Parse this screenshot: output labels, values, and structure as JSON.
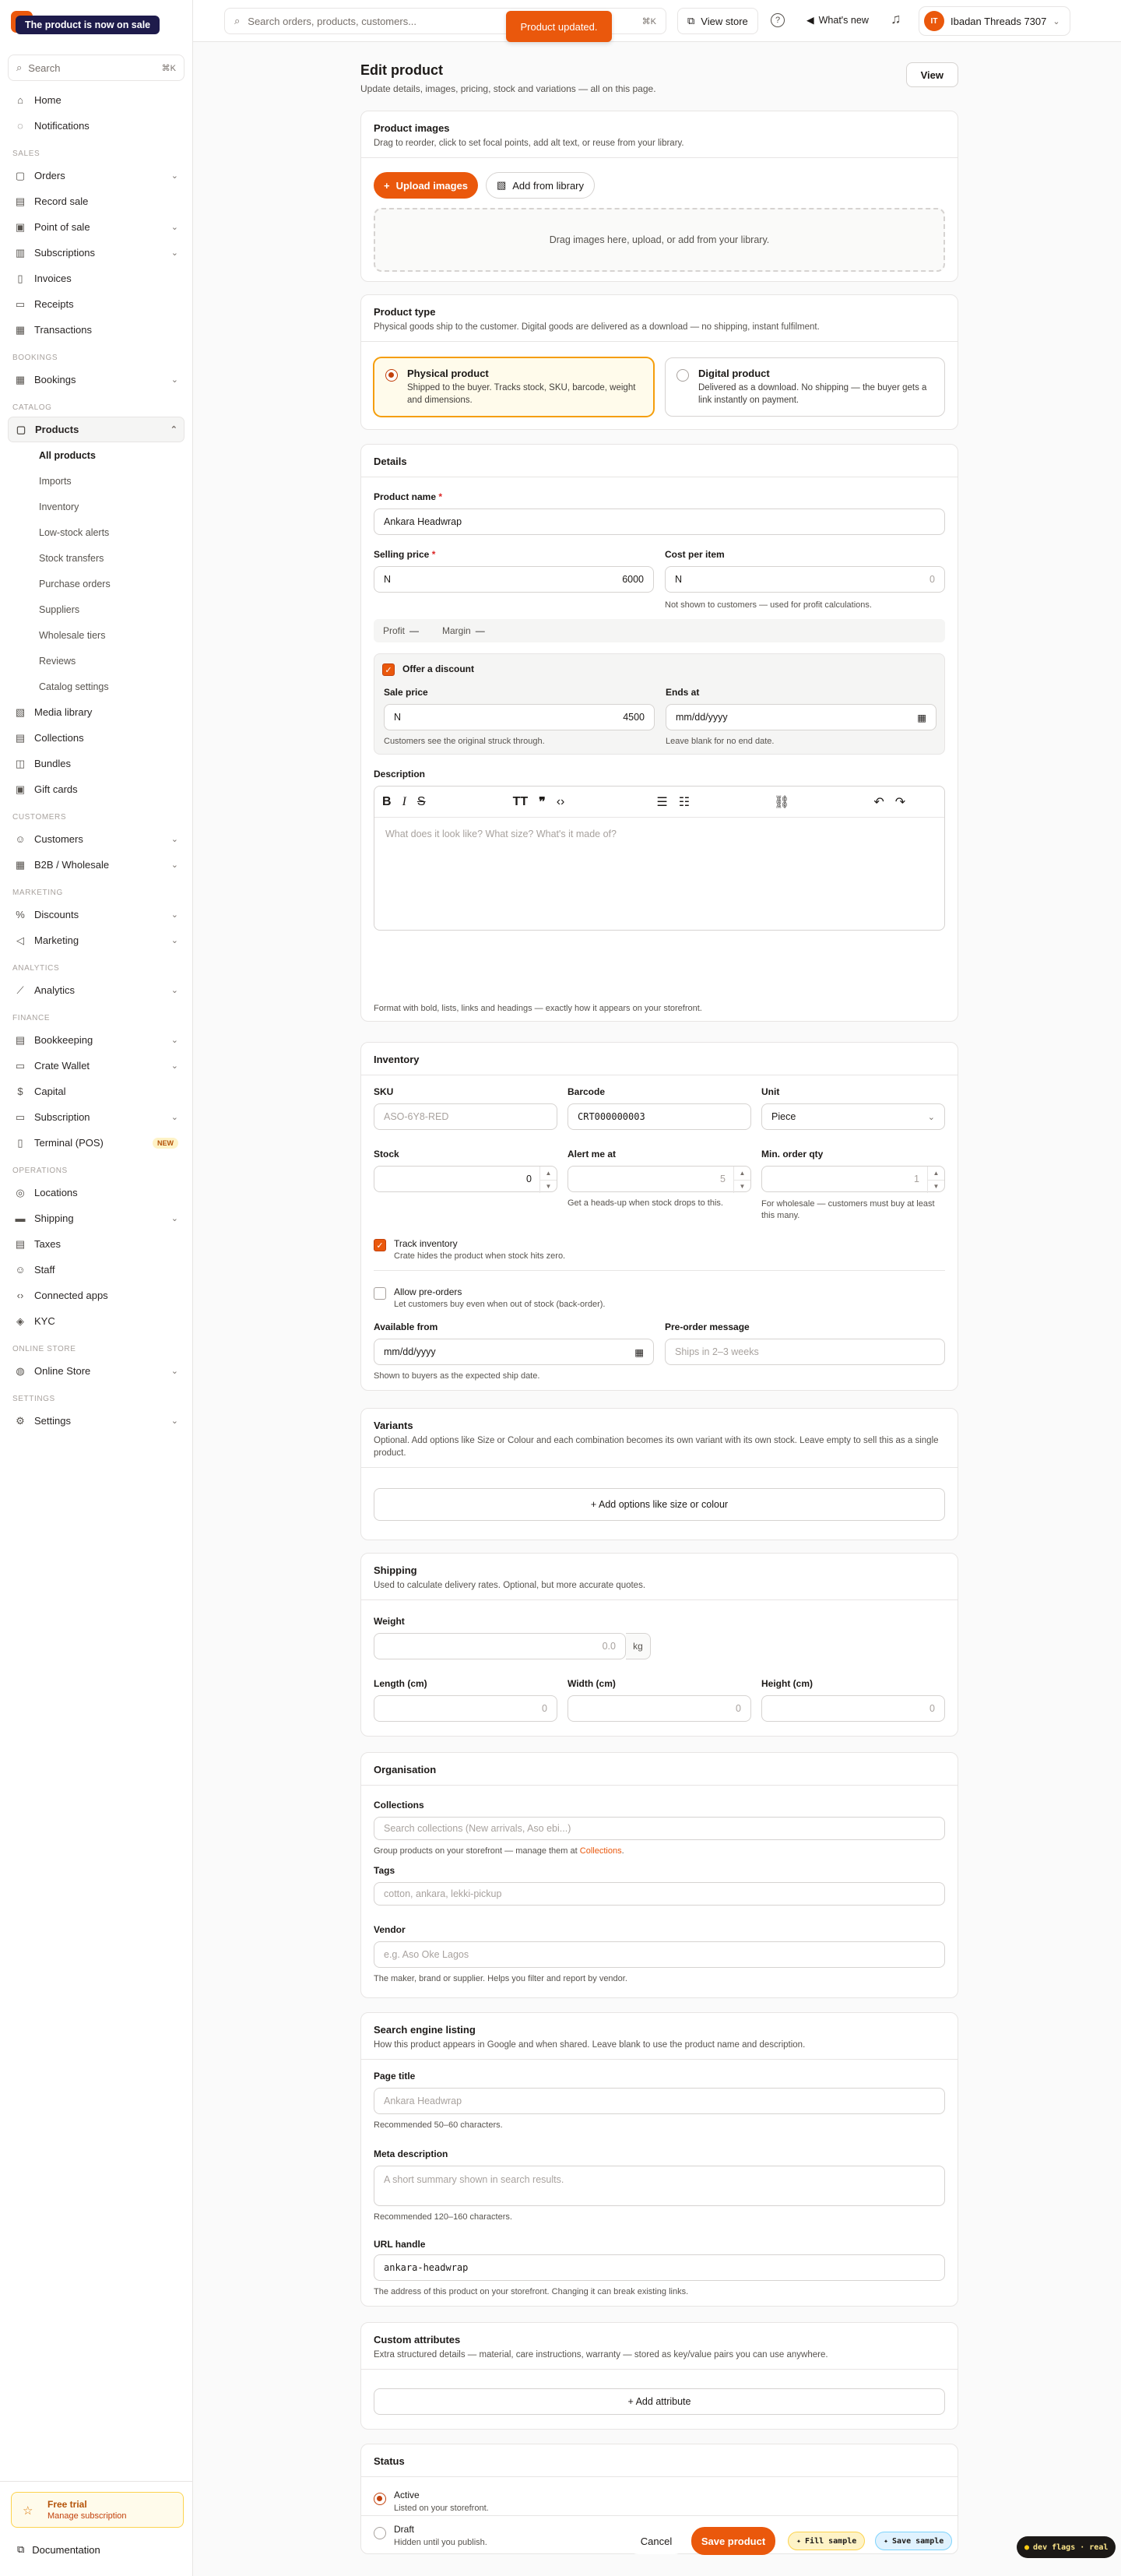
{
  "toast": {
    "sale": "The product is now on sale",
    "updated": "Product updated."
  },
  "sidebar": {
    "subtitle": "",
    "search": {
      "placeholder": "Search",
      "kbd": "⌘K"
    },
    "sections": {
      "sales": "SALES",
      "bookings": "BOOKINGS",
      "catalog": "CATALOG",
      "customers": "CUSTOMERS",
      "marketing": "MARKETING",
      "analytics": "ANALYTICS",
      "finance": "FINANCE",
      "operations": "OPERATIONS",
      "online_store": "ONLINE STORE",
      "settings": "SETTINGS"
    },
    "items": {
      "home": "Home",
      "notifications": "Notifications",
      "orders": "Orders",
      "record_sale": "Record sale",
      "pos": "Point of sale",
      "subscriptions": "Subscriptions",
      "invoices": "Invoices",
      "receipts": "Receipts",
      "transactions": "Transactions",
      "bookings": "Bookings",
      "products": "Products",
      "media": "Media library",
      "collections": "Collections",
      "bundles": "Bundles",
      "gift_cards": "Gift cards",
      "customers": "Customers",
      "b2b": "B2B / Wholesale",
      "discounts": "Discounts",
      "marketing": "Marketing",
      "analytics": "Analytics",
      "bookkeeping": "Bookkeeping",
      "wallet": "Crate Wallet",
      "capital": "Capital",
      "subscription": "Subscription",
      "terminal": "Terminal (POS)",
      "terminal_badge": "NEW",
      "locations": "Locations",
      "shipping": "Shipping",
      "taxes": "Taxes",
      "staff": "Staff",
      "connected": "Connected apps",
      "kyc": "KYC",
      "online_store": "Online Store",
      "settings": "Settings"
    },
    "product_sub": [
      "All products",
      "Imports",
      "Inventory",
      "Low-stock alerts",
      "Stock transfers",
      "Purchase orders",
      "Suppliers",
      "Wholesale tiers",
      "Reviews",
      "Catalog settings"
    ],
    "trial": {
      "title": "Free trial",
      "link": "Manage subscription"
    },
    "docs": "Documentation"
  },
  "topbar": {
    "search_placeholder": "Search orders, products, customers...",
    "kbd": "⌘K",
    "view_store": "View store",
    "whats_new": "What's new",
    "account": {
      "initials": "IT",
      "name": "Ibadan Threads 7307"
    }
  },
  "page": {
    "title": "Edit product",
    "subtitle": "Update details, images, pricing, stock and variations — all on this page.",
    "view": "View"
  },
  "images": {
    "title": "Product images",
    "desc": "Drag to reorder, click to set focal points, add alt text, or reuse from your library.",
    "upload": "Upload images",
    "library": "Add from library",
    "drop": "Drag images here, upload, or add from your library."
  },
  "type": {
    "title": "Product type",
    "desc": "Physical goods ship to the customer. Digital goods are delivered as a download — no shipping, instant fulfilment.",
    "physical": {
      "title": "Physical product",
      "desc": "Shipped to the buyer. Tracks stock, SKU, barcode, weight and dimensions."
    },
    "digital": {
      "title": "Digital product",
      "desc": "Delivered as a download. No shipping — the buyer gets a link instantly on payment."
    }
  },
  "details": {
    "title": "Details",
    "name_label": "Product name",
    "name_value": "Ankara Headwrap",
    "price_label": "Selling price",
    "currency": "N",
    "price_value": "6000",
    "cost_label": "Cost per item",
    "cost_placeholder": "0",
    "cost_help": "Not shown to customers — used for profit calculations.",
    "profit": "Profit",
    "profit_val": "—",
    "margin": "Margin",
    "margin_val": "—",
    "discount_label": "Offer a discount",
    "sale_label": "Sale price",
    "sale_value": "4500",
    "sale_help": "Customers see the original struck through.",
    "ends_label": "Ends at",
    "ends_placeholder": "mm/dd/yyyy",
    "ends_help": "Leave blank for no end date.",
    "desc_label": "Description",
    "desc_placeholder": "What does it look like? What size? What's it made of?",
    "desc_help": "Format with bold, lists, links and headings — exactly how it appears on your storefront."
  },
  "inventory": {
    "title": "Inventory",
    "sku_label": "SKU",
    "sku_placeholder": "ASO-6Y8-RED",
    "barcode_label": "Barcode",
    "barcode_value": "CRT000000003",
    "unit_label": "Unit",
    "unit_value": "Piece",
    "stock_label": "Stock",
    "stock_value": "0",
    "alert_label": "Alert me at",
    "alert_placeholder": "5",
    "alert_help": "Get a heads-up when stock drops to this.",
    "min_label": "Min. order qty",
    "min_placeholder": "1",
    "min_help": "For wholesale — customers must buy at least this many.",
    "track_label": "Track inventory",
    "track_help": "Crate hides the product when stock hits zero.",
    "preorder_label": "Allow pre-orders",
    "preorder_help": "Let customers buy even when out of stock (back-order).",
    "avail_label": "Available from",
    "avail_placeholder": "mm/dd/yyyy",
    "avail_help": "Shown to buyers as the expected ship date.",
    "premsg_label": "Pre-order message",
    "premsg_placeholder": "Ships in 2–3 weeks"
  },
  "variants": {
    "title": "Variants",
    "desc": "Optional. Add options like Size or Colour and each combination becomes its own variant with its own stock. Leave empty to sell this as a single product.",
    "add": "+ Add options like size or colour"
  },
  "shipping": {
    "title": "Shipping",
    "desc": "Used to calculate delivery rates. Optional, but more accurate quotes.",
    "weight_label": "Weight",
    "weight_placeholder": "0.0",
    "weight_unit": "kg",
    "length_label": "Length (cm)",
    "width_label": "Width (cm)",
    "height_label": "Height (cm)",
    "dim_placeholder": "0"
  },
  "organisation": {
    "title": "Organisation",
    "collections_label": "Collections",
    "collections_placeholder": "Search collections (New arrivals, Aso ebi...)",
    "collections_help": "Group products on your storefront — manage them at",
    "collections_link": "Collections",
    "collections_tail": ".",
    "tags_label": "Tags",
    "tags_placeholder": "cotton, ankara, lekki-pickup",
    "vendor_label": "Vendor",
    "vendor_placeholder": "e.g. Aso Oke Lagos",
    "vendor_help": "The maker, brand or supplier. Helps you filter and report by vendor."
  },
  "seo": {
    "title": "Search engine listing",
    "desc": "How this product appears in Google and when shared. Leave blank to use the product name and description.",
    "page_title_label": "Page title",
    "page_title_placeholder": "Ankara Headwrap",
    "page_title_help": "Recommended 50–60 characters.",
    "meta_label": "Meta description",
    "meta_placeholder": "A short summary shown in search results.",
    "meta_help": "Recommended 120–160 characters.",
    "handle_label": "URL handle",
    "handle_value": "ankara-headwrap",
    "handle_help": "The address of this product on your storefront. Changing it can break existing links."
  },
  "custom": {
    "title": "Custom attributes",
    "desc": "Extra structured details — material, care instructions, warranty — stored as key/value pairs you can use anywhere.",
    "add": "+ Add attribute"
  },
  "status": {
    "title": "Status",
    "active": "Active",
    "active_desc": "Listed on your storefront.",
    "draft": "Draft",
    "draft_desc": "Hidden until you publish."
  },
  "footer": {
    "cancel": "Cancel",
    "save": "Save product",
    "fill": "Fill sample",
    "save_sample": "Save sample",
    "dev": "dev flags · real"
  },
  "colors": {
    "accent": "#ea580c",
    "selected_border": "#f59e0b"
  }
}
